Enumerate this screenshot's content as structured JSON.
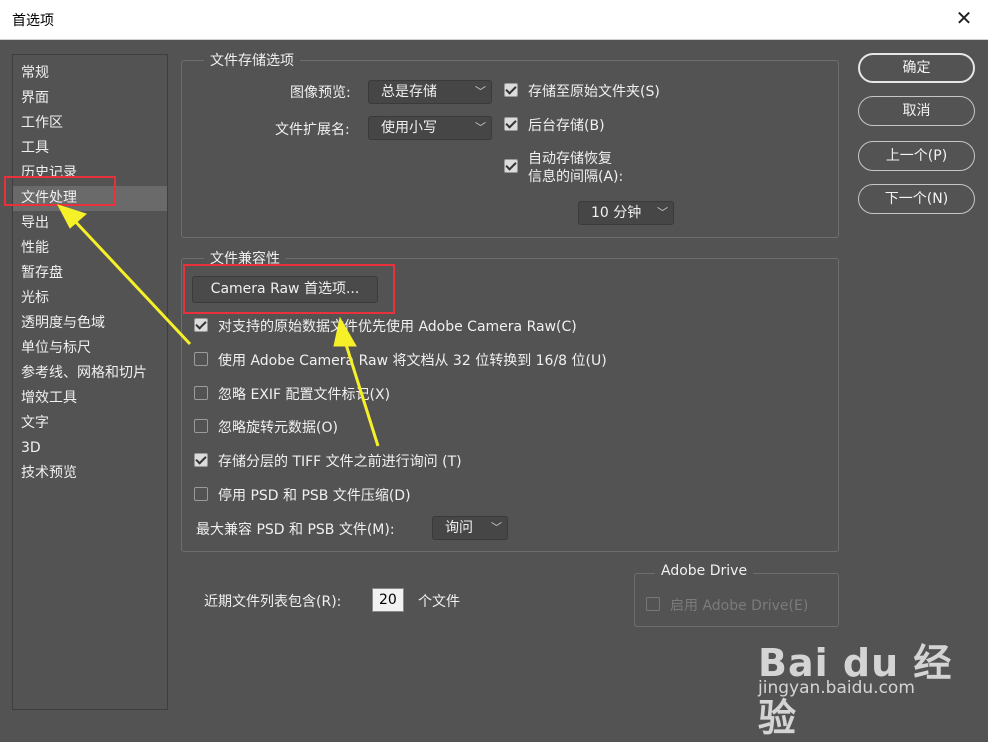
{
  "window": {
    "title": "首选项",
    "close_glyph": "✕"
  },
  "sidebar": {
    "items": [
      {
        "label": "常规"
      },
      {
        "label": "界面"
      },
      {
        "label": "工作区"
      },
      {
        "label": "工具"
      },
      {
        "label": "历史记录"
      },
      {
        "label": "文件处理",
        "selected": true
      },
      {
        "label": "导出"
      },
      {
        "label": "性能"
      },
      {
        "label": "暂存盘"
      },
      {
        "label": "光标"
      },
      {
        "label": "透明度与色域"
      },
      {
        "label": "单位与标尺"
      },
      {
        "label": "参考线、网格和切片"
      },
      {
        "label": "增效工具"
      },
      {
        "label": "文字"
      },
      {
        "label": "3D"
      },
      {
        "label": "技术预览"
      }
    ]
  },
  "file_saving": {
    "title": "文件存储选项",
    "image_preview_label": "图像预览:",
    "image_preview_value": "总是存储",
    "file_ext_label": "文件扩展名:",
    "file_ext_value": "使用小写",
    "save_to_original": "存储至原始文件夹(S)",
    "background_save": "后台存储(B)",
    "auto_save_line1": "自动存储恢复",
    "auto_save_line2": "信息的间隔(A):",
    "interval_value": "10 分钟"
  },
  "compat": {
    "title": "文件兼容性",
    "camera_raw_button": "Camera Raw 首选项...",
    "options": [
      {
        "label": "对支持的原始数据文件优先使用 Adobe Camera Raw(C)",
        "checked": true
      },
      {
        "label": "使用 Adobe Camera Raw 将文档从 32 位转换到 16/8 位(U)",
        "checked": false
      },
      {
        "label": "忽略 EXIF 配置文件标记(X)",
        "checked": false
      },
      {
        "label": "忽略旋转元数据(O)",
        "checked": false
      },
      {
        "label": "存储分层的 TIFF 文件之前进行询问 (T)",
        "checked": true
      },
      {
        "label": "停用 PSD 和 PSB 文件压缩(D)",
        "checked": false
      }
    ],
    "max_compat_label": "最大兼容 PSD 和 PSB 文件(M):",
    "max_compat_value": "询问"
  },
  "recent": {
    "label": "近期文件列表包含(R):",
    "value": "20",
    "suffix": "个文件"
  },
  "adobe_drive": {
    "title": "Adobe Drive",
    "enable_label": "启用 Adobe Drive(E)"
  },
  "buttons": {
    "ok": "确定",
    "cancel": "取消",
    "prev": "上一个(P)",
    "next": "下一个(N)"
  },
  "watermark": {
    "brand": "Bai du 经验",
    "url": "jingyan.baidu.com"
  },
  "colors": {
    "background": "#535353",
    "annotation_red": "#e8313a",
    "annotation_yellow": "#f5f028"
  }
}
